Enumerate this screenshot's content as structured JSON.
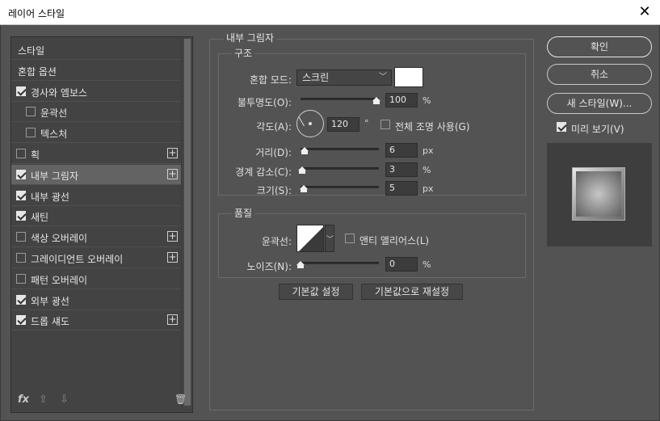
{
  "window": {
    "title": "레이어 스타일",
    "close_label": "✕"
  },
  "list": {
    "items": [
      {
        "label": "스타일",
        "checkbox": false,
        "checked": false,
        "plus": false,
        "indent": false,
        "selected": false
      },
      {
        "label": "혼합 옵션",
        "checkbox": false,
        "checked": false,
        "plus": false,
        "indent": false,
        "selected": false
      },
      {
        "label": "경사와 엠보스",
        "checkbox": true,
        "checked": true,
        "plus": false,
        "indent": false,
        "selected": false
      },
      {
        "label": "윤곽선",
        "checkbox": true,
        "checked": false,
        "plus": false,
        "indent": true,
        "selected": false
      },
      {
        "label": "텍스처",
        "checkbox": true,
        "checked": false,
        "plus": false,
        "indent": true,
        "selected": false
      },
      {
        "label": "획",
        "checkbox": true,
        "checked": false,
        "plus": true,
        "indent": false,
        "selected": false
      },
      {
        "label": "내부 그림자",
        "checkbox": true,
        "checked": true,
        "plus": true,
        "indent": false,
        "selected": true
      },
      {
        "label": "내부 광선",
        "checkbox": true,
        "checked": true,
        "plus": false,
        "indent": false,
        "selected": false
      },
      {
        "label": "새틴",
        "checkbox": true,
        "checked": true,
        "plus": false,
        "indent": false,
        "selected": false
      },
      {
        "label": "색상 오버레이",
        "checkbox": true,
        "checked": false,
        "plus": true,
        "indent": false,
        "selected": false
      },
      {
        "label": "그레이디언트 오버레이",
        "checkbox": true,
        "checked": false,
        "plus": true,
        "indent": false,
        "selected": false
      },
      {
        "label": "패턴 오버레이",
        "checkbox": true,
        "checked": false,
        "plus": false,
        "indent": false,
        "selected": false
      },
      {
        "label": "외부 광선",
        "checkbox": true,
        "checked": true,
        "plus": false,
        "indent": false,
        "selected": false
      },
      {
        "label": "드롭 섀도",
        "checkbox": true,
        "checked": true,
        "plus": true,
        "indent": false,
        "selected": false
      }
    ],
    "bottom": {
      "fx": "fx",
      "up": "⇧",
      "down": "⇩",
      "trash": "🗑"
    }
  },
  "inner_shadow": {
    "title": "내부 그림자",
    "structure": {
      "title": "구조",
      "blend_mode_label": "혼합 모드:",
      "blend_mode_value": "스크린",
      "color_swatch": "#ffffff",
      "opacity_label": "불투명도(O):",
      "opacity_value": "100",
      "opacity_unit": "%",
      "angle_label": "각도(A):",
      "angle_value": "120",
      "angle_unit": "°",
      "global_light_label": "전체 조명 사용(G)",
      "global_light_checked": false,
      "distance_label": "거리(D):",
      "distance_value": "6",
      "distance_unit": "px",
      "choke_label": "경계 감소(C):",
      "choke_value": "3",
      "choke_unit": "%",
      "size_label": "크기(S):",
      "size_value": "5",
      "size_unit": "px"
    },
    "quality": {
      "title": "품질",
      "contour_label": "윤곽선:",
      "antialias_label": "앤티 앨리어스(L)",
      "antialias_checked": false,
      "noise_label": "노이즈(N):",
      "noise_value": "0",
      "noise_unit": "%"
    },
    "make_default_label": "기본값 설정",
    "reset_default_label": "기본값으로 재설정"
  },
  "actions": {
    "ok_label": "확인",
    "cancel_label": "취소",
    "new_style_label": "새 스타일(W)...",
    "preview_label": "미리 보기(V)",
    "preview_checked": true
  }
}
